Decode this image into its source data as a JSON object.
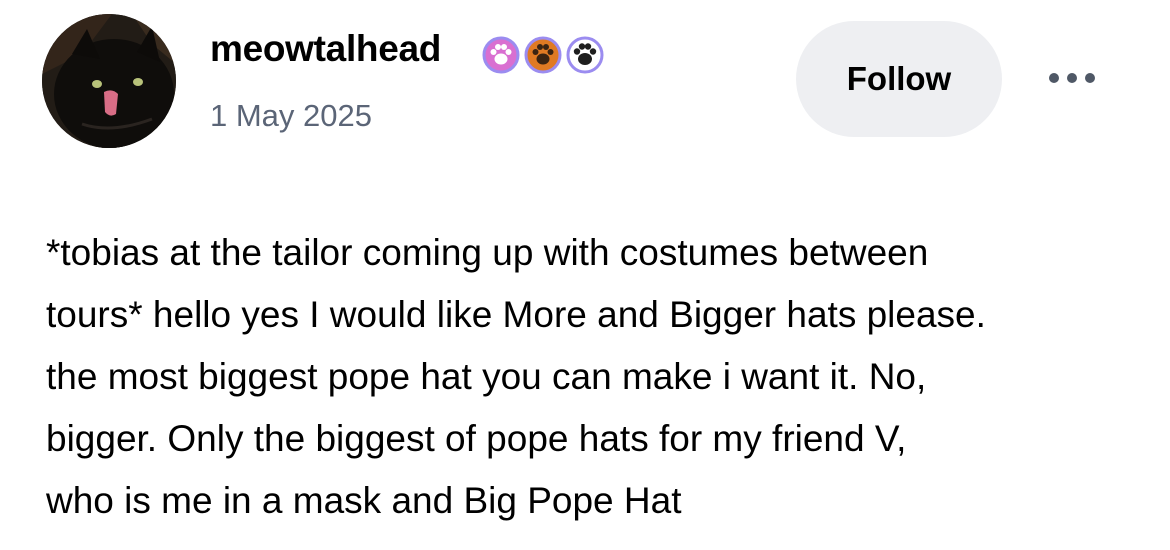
{
  "post": {
    "username": "meowtalhead",
    "timestamp": "1 May 2025",
    "follow_label": "Follow",
    "avatar_icon": "black-cat-avatar",
    "more_icon": "ellipsis-icon",
    "badges": [
      {
        "icon": "paw-badge-icon",
        "color": "#d96fd1"
      },
      {
        "icon": "paw-badge-icon",
        "color": "#e07a23"
      },
      {
        "icon": "paw-badge-icon",
        "color": "#2a2a2a"
      }
    ],
    "body_lines": [
      "*tobias at the tailor coming up with costumes between",
      "tours* hello yes I would like More and Bigger hats please.",
      "the most biggest pope hat you can make i want it. No,",
      "bigger. Only the biggest of pope hats for my friend V,",
      "who is me in a mask and Big Pope Hat"
    ]
  },
  "colors": {
    "timestamp": "#5b6577",
    "follow_bg": "#eeeff2",
    "badge_ring": "#9b8cf0",
    "text": "#000000"
  }
}
